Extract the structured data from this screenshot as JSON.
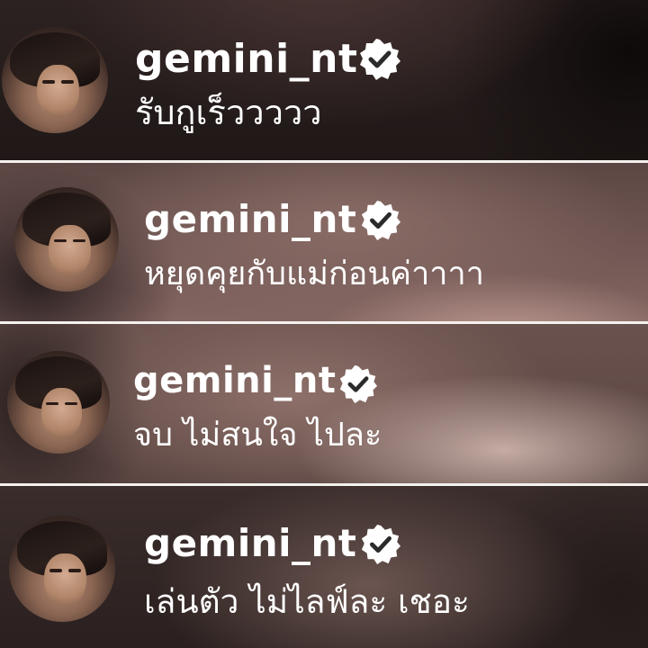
{
  "comments": [
    {
      "username": "gemini_nt",
      "verified": true,
      "text": "รับกูเร็ววววว",
      "avatar_icon": "profile-avatar"
    },
    {
      "username": "gemini_nt",
      "verified": true,
      "text": "หยุดคุยกับแม่ก่อนค่าาาา",
      "avatar_icon": "profile-avatar"
    },
    {
      "username": "gemini_nt",
      "verified": true,
      "text": "จบ ไม่สนใจ ไปละ",
      "avatar_icon": "profile-avatar"
    },
    {
      "username": "gemini_nt",
      "verified": true,
      "text": "เล่นตัว ไม่ไลฟ์ละ เชอะ",
      "avatar_icon": "profile-avatar"
    }
  ],
  "colors": {
    "text": "#ffffff",
    "divider": "#f4f1ee",
    "badge_fill": "#ffffff",
    "badge_check": "#2b2b2b"
  }
}
